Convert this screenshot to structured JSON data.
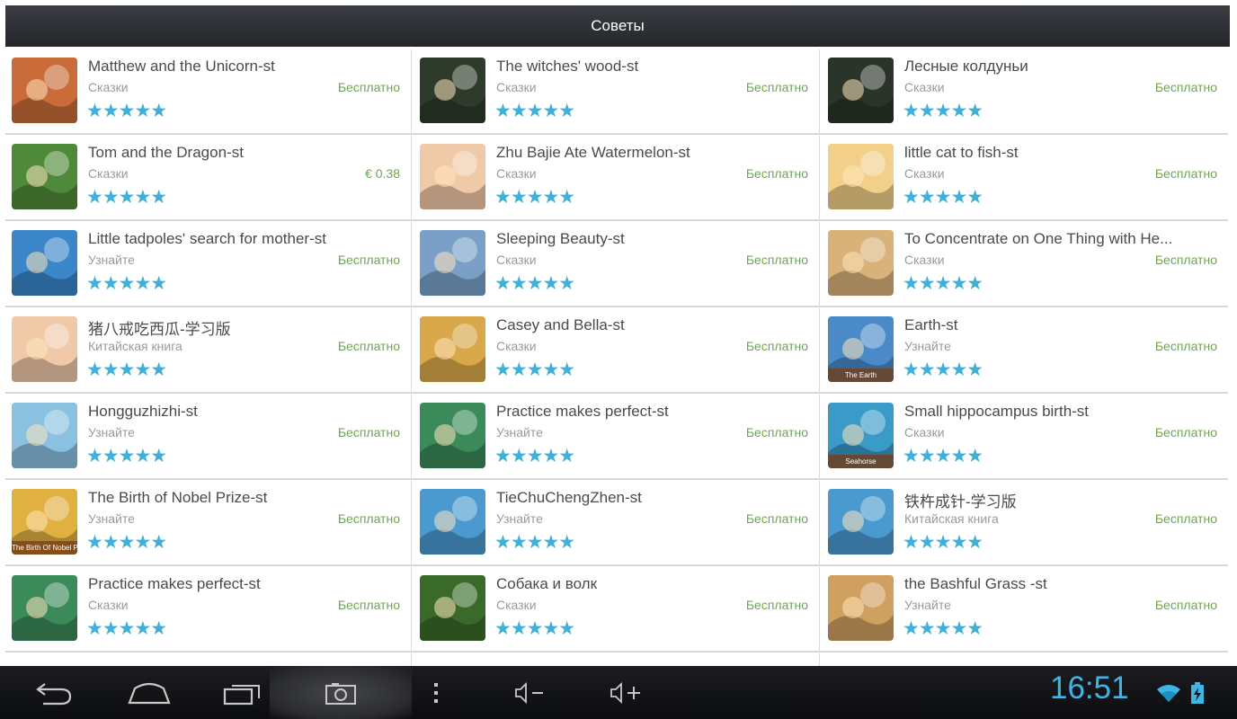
{
  "header": {
    "title": "Советы"
  },
  "apps": [
    {
      "title": "Matthew and the Unicorn-st",
      "category": "Сказки",
      "price": "Бесплатно",
      "rating": 5,
      "icon": "unicorn-book-icon",
      "color": "#c96c3a"
    },
    {
      "title": "The witches' wood-st",
      "category": "Сказки",
      "price": "Бесплатно",
      "rating": 5,
      "icon": "witches-wood-icon",
      "color": "#2e3a2a"
    },
    {
      "title": "Лесные колдуньи",
      "category": "Сказки",
      "price": "Бесплатно",
      "rating": 5,
      "icon": "forest-witch-icon",
      "color": "#2a3428"
    },
    {
      "title": "Tom and the Dragon-st",
      "category": "Сказки",
      "price": "€ 0.38",
      "rating": 5,
      "icon": "dragon-icon",
      "color": "#4f8a3a"
    },
    {
      "title": "Zhu Bajie Ate Watermelon-st",
      "category": "Сказки",
      "price": "Бесплатно",
      "rating": 5,
      "icon": "pig-icon",
      "color": "#f0c9a8"
    },
    {
      "title": "little cat to fish-st",
      "category": "Сказки",
      "price": "Бесплатно",
      "rating": 5,
      "icon": "cat-icon",
      "color": "#f2d08a"
    },
    {
      "title": "Little tadpoles' search for mother-st",
      "category": "Узнайте",
      "price": "Бесплатно",
      "rating": 5,
      "icon": "frog-icon",
      "color": "#3a86c8"
    },
    {
      "title": "Sleeping Beauty-st",
      "category": "Сказки",
      "price": "Бесплатно",
      "rating": 5,
      "icon": "castle-icon",
      "color": "#7aa0c8"
    },
    {
      "title": "To Concentrate on One Thing with He...",
      "category": "Сказки",
      "price": "Бесплатно",
      "rating": 5,
      "icon": "boy-reading-icon",
      "color": "#d9b27a"
    },
    {
      "title": "猪八戒吃西瓜-学习版",
      "category": "Китайская книга",
      "price": "Бесплатно",
      "rating": 5,
      "icon": "pig-icon",
      "color": "#f0c9a8"
    },
    {
      "title": "Casey and Bella-st",
      "category": "Сказки",
      "price": "Бесплатно",
      "rating": 5,
      "icon": "books-icon",
      "color": "#d8a84a"
    },
    {
      "title": "Earth-st",
      "category": "Узнайте",
      "price": "Бесплатно",
      "rating": 5,
      "icon": "earth-icon",
      "color": "#4a8ac8",
      "badge": "The Earth"
    },
    {
      "title": "Hongguzhizhi-st",
      "category": "Узнайте",
      "price": "Бесплатно",
      "rating": 5,
      "icon": "bird-boy-icon",
      "color": "#8ac0e0"
    },
    {
      "title": "Practice makes perfect-st",
      "category": "Узнайте",
      "price": "Бесплатно",
      "rating": 5,
      "icon": "boy-books-icon",
      "color": "#3a8a5a"
    },
    {
      "title": "Small hippocampus birth-st",
      "category": "Сказки",
      "price": "Бесплатно",
      "rating": 5,
      "icon": "seahorse-icon",
      "color": "#3a9ac8",
      "badge": "Seahorse"
    },
    {
      "title": "The Birth of Nobel Prize-st",
      "category": "Узнайте",
      "price": "Бесплатно",
      "rating": 5,
      "icon": "nobel-icon",
      "color": "#e0b040",
      "badge": "The Birth Of Nobel Prize"
    },
    {
      "title": "TieChuChengZhen-st",
      "category": "Узнайте",
      "price": "Бесплатно",
      "rating": 5,
      "icon": "boy-running-icon",
      "color": "#4a9ad0"
    },
    {
      "title": "铁杵成针-学习版",
      "category": "Китайская книга",
      "price": "Бесплатно",
      "rating": 5,
      "icon": "boy-running-icon",
      "color": "#4a9ad0"
    },
    {
      "title": "Practice makes perfect-st",
      "category": "Сказки",
      "price": "Бесплатно",
      "rating": 5,
      "icon": "boy-books-icon",
      "color": "#3a8a5a"
    },
    {
      "title": "Собака и волк",
      "category": "Сказки",
      "price": "Бесплатно",
      "rating": 5,
      "icon": "dog-wolf-icon",
      "color": "#3a6a2a"
    },
    {
      "title": "the Bashful Grass -st",
      "category": "Узнайте",
      "price": "Бесплатно",
      "rating": 5,
      "icon": "girl-icon",
      "color": "#d0a060"
    }
  ],
  "status": {
    "time": "16:51"
  },
  "colors": {
    "accent": "#3fb1d9",
    "price_free": "#6aa84f",
    "topbar": "#2a2c30"
  },
  "navbar": [
    "back-icon",
    "home-icon",
    "recent-apps-icon",
    "screenshot-icon",
    "menu-icon",
    "volume-down-icon",
    "volume-up-icon"
  ]
}
